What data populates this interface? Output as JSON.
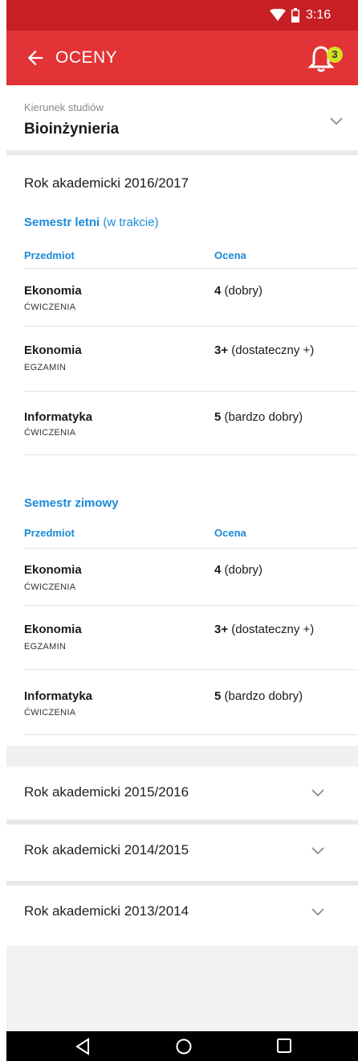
{
  "status_bar": {
    "time": "3:16"
  },
  "app_bar": {
    "title": "OCENY",
    "notification_count": "3"
  },
  "kierunek": {
    "label": "Kierunek studiów",
    "value": "Bioinżynieria"
  },
  "current_year": {
    "title": "Rok akademicki 2016/2017",
    "semesters": [
      {
        "title": "Semestr letni",
        "status": "(w trakcie)",
        "col_subject": "Przedmiot",
        "col_grade": "Ocena",
        "rows": [
          {
            "subject": "Ekonomia",
            "form": "ĆWICZENIA",
            "grade_num": "4",
            "grade_text": "(dobry)"
          },
          {
            "subject": "Ekonomia",
            "form": "EGZAMIN",
            "grade_num": "3+",
            "grade_text": "(dostateczny +)"
          },
          {
            "subject": "Informatyka",
            "form": "ĆWICZENIA",
            "grade_num": "5",
            "grade_text": "(bardzo dobry)"
          }
        ]
      },
      {
        "title": "Semestr zimowy",
        "status": "",
        "col_subject": "Przedmiot",
        "col_grade": "Ocena",
        "rows": [
          {
            "subject": "Ekonomia",
            "form": "ĆWICZENIA",
            "grade_num": "4",
            "grade_text": "(dobry)"
          },
          {
            "subject": "Ekonomia",
            "form": "EGZAMIN",
            "grade_num": "3+",
            "grade_text": "(dostateczny +)"
          },
          {
            "subject": "Informatyka",
            "form": "ĆWICZENIA",
            "grade_num": "5",
            "grade_text": "(bardzo dobry)"
          }
        ]
      }
    ]
  },
  "past_years": [
    {
      "label": "Rok akademicki 2015/2016"
    },
    {
      "label": "Rok akademicki 2014/2015"
    },
    {
      "label": "Rok akademicki 2013/2014"
    }
  ],
  "colors": {
    "status_bar": "#c81f24",
    "app_bar": "#e23336",
    "accent_blue": "#1a8ad9",
    "badge": "#d3e024"
  },
  "icons": {
    "back": "arrow-left-icon",
    "notifications": "bell-icon",
    "expand": "chevron-down-icon",
    "nav_back": "triangle-back-icon",
    "nav_home": "circle-home-icon",
    "nav_recents": "square-recents-icon"
  }
}
